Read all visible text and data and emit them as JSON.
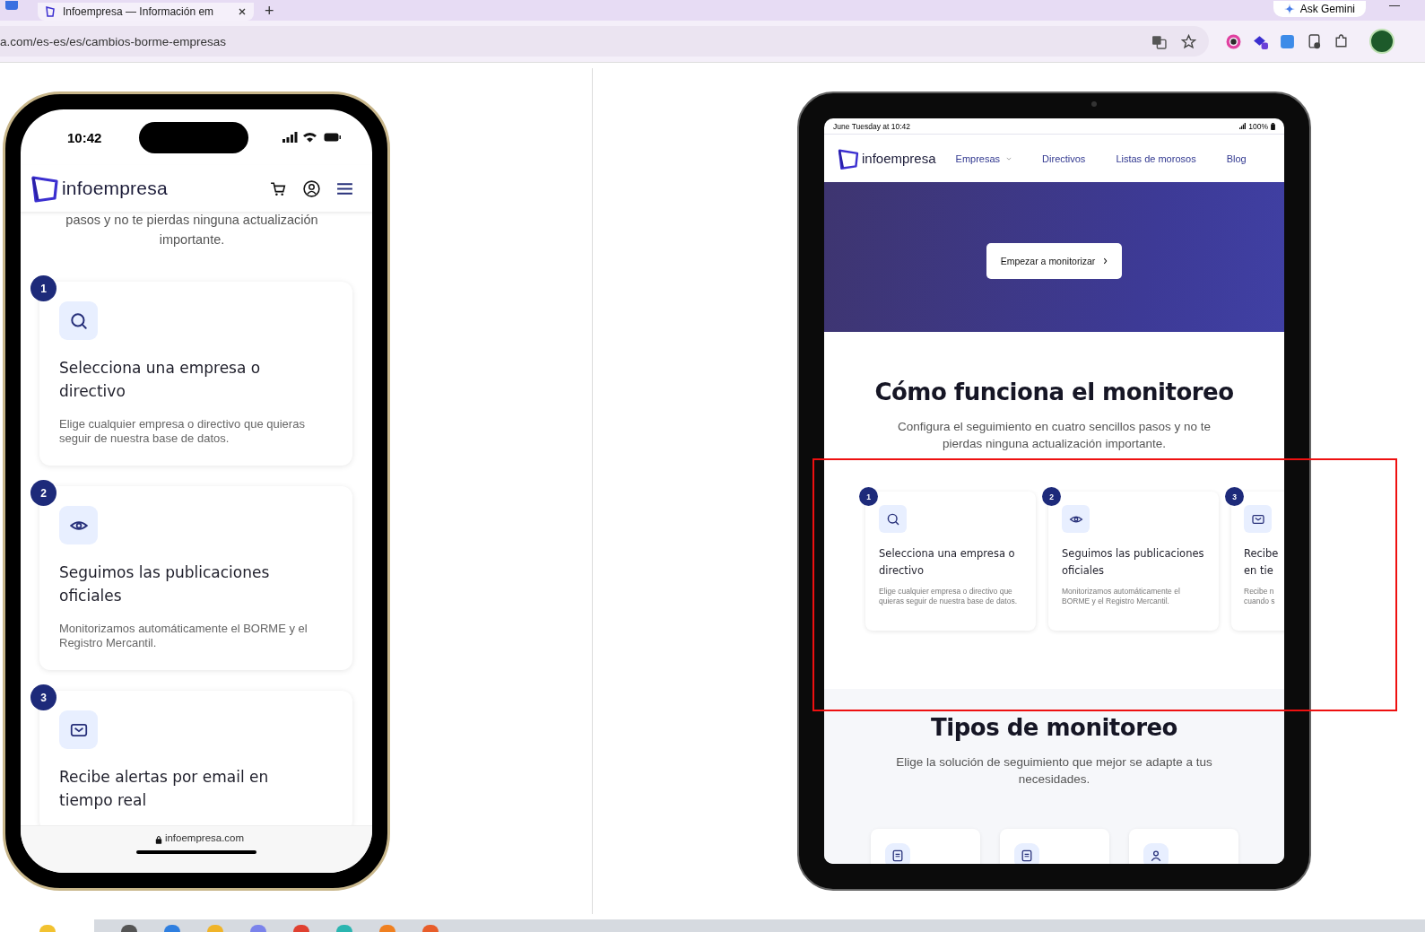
{
  "browser": {
    "tab": {
      "title": "Infoempresa — Información em",
      "selected": true
    },
    "new_tab": "+",
    "ask_gemini": "Ask Gemini",
    "url": "a.com/es-es/es/cambios-borme-empresas"
  },
  "phone": {
    "time": "10:42",
    "logo": "infoempresa",
    "intro": "pasos y no te pierdas ninguna actualización importante.",
    "steps": [
      {
        "number": "1",
        "kind": "search",
        "title": "Selecciona una empresa o directivo",
        "text": "Elige cualquier empresa o directivo que quieras seguir de nuestra base de datos."
      },
      {
        "number": "2",
        "kind": "eye",
        "title": "Seguimos las publicaciones oficiales",
        "text": "Monitorizamos automáticamente el BORME y el Registro Mercantil."
      },
      {
        "number": "3",
        "kind": "mail",
        "title": "Recibe alertas por email en tiempo real"
      }
    ],
    "url": "infoempresa.com"
  },
  "tablet": {
    "date": "June Tuesday at 10:42",
    "battery": "100%",
    "logo": "infoempresa",
    "nav": [
      {
        "label": "Empresas",
        "dropdown": true
      },
      {
        "label": "Directivos",
        "dropdown": false
      },
      {
        "label": "Listas de morosos",
        "dropdown": false
      },
      {
        "label": "Blog",
        "dropdown": false
      }
    ],
    "cta": "Empezar a monitorizar",
    "title": "Cómo funciona el monitoreo",
    "subtitle": "Configura el seguimiento en cuatro sencillos pasos y no te pierdas ninguna actualización importante.",
    "steps": [
      {
        "number": "1",
        "kind": "search",
        "title": "Selecciona una empresa o directivo",
        "text": "Elige cualquier empresa o directivo que quieras seguir de nuestra base de datos.",
        "cut": false
      },
      {
        "number": "2",
        "kind": "eye",
        "title": "Seguimos las publicaciones oficiales",
        "text": "Monitorizamos automáticamente el BORME y el Registro Mercantil.",
        "cut": false
      },
      {
        "number": "3",
        "kind": "mail",
        "title": "Recibe en tie",
        "text": "Recibe n cuando s",
        "cut": true
      }
    ],
    "types_title": "Tipos de monitoreo",
    "types_subtitle": "Elige la solución de seguimiento que mejor se adapte a tus necesidades.",
    "types": [
      {
        "kind": "document"
      },
      {
        "kind": "document"
      },
      {
        "kind": "person"
      }
    ]
  }
}
